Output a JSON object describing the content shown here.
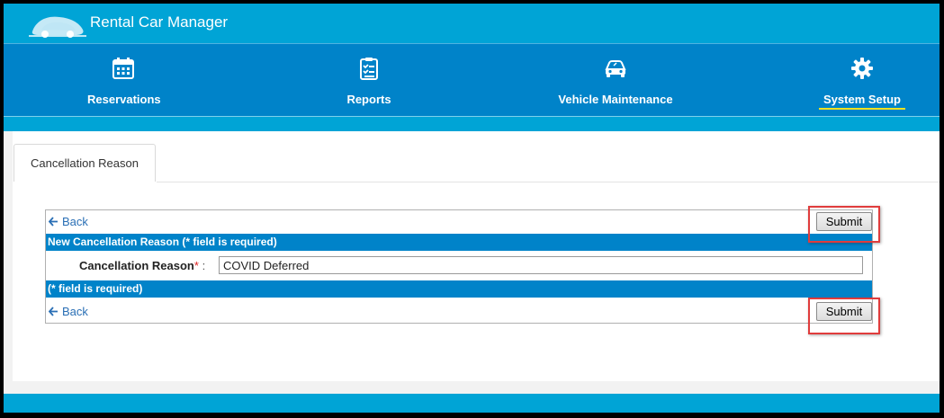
{
  "app": {
    "title": "Rental Car Manager"
  },
  "nav": {
    "items": [
      {
        "label": "Reservations",
        "icon": "calendar-icon"
      },
      {
        "label": "Reports",
        "icon": "checklist-icon"
      },
      {
        "label": "Vehicle Maintenance",
        "icon": "car-icon"
      },
      {
        "label": "System Setup",
        "icon": "gear-icon",
        "active": true
      }
    ]
  },
  "tab": {
    "label": "Cancellation Reason"
  },
  "form": {
    "back_label": "Back",
    "submit_label": "Submit",
    "header": "New Cancellation Reason (* field is required)",
    "field_label": "Cancellation Reason",
    "required_mark": "*",
    "colon": ":",
    "field_value": "COVID Deferred",
    "footer_note": "(* field is required)"
  },
  "colors": {
    "title_bar": "#00a4d6",
    "nav_bar": "#0083c9",
    "active_underline": "#f5e020",
    "highlight": "#e03c3c",
    "link": "#2a6fb5"
  }
}
